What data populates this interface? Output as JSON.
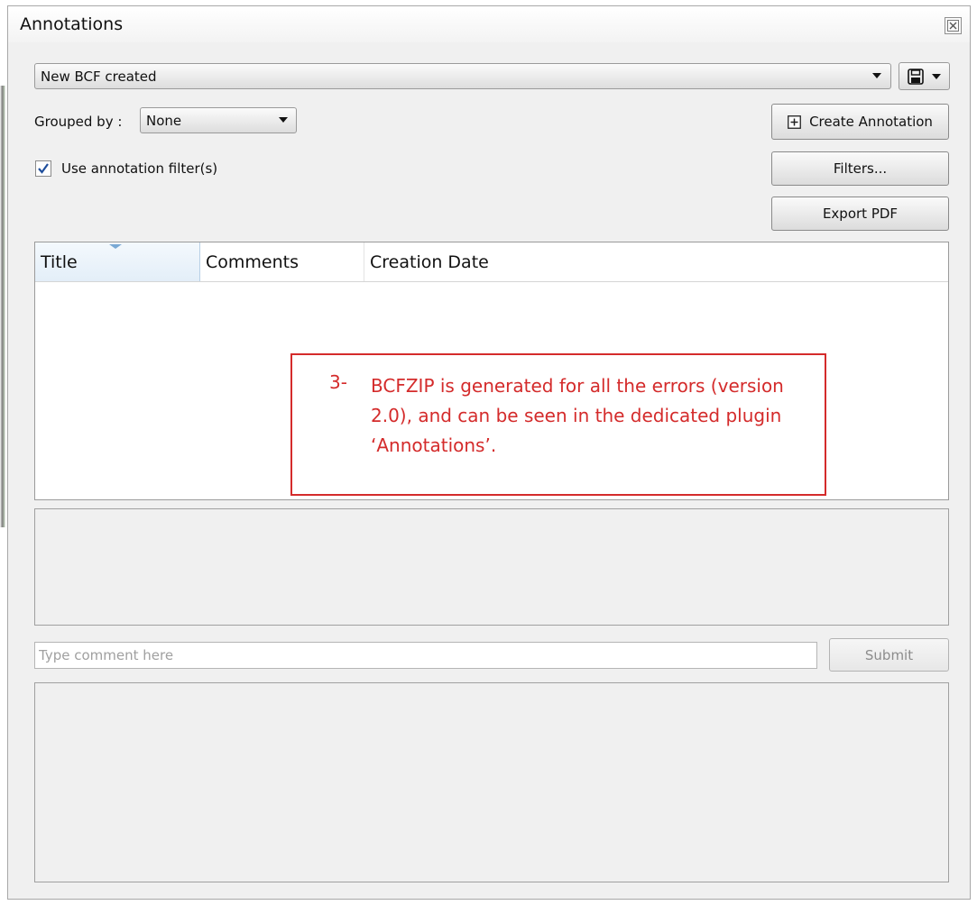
{
  "window": {
    "title": "Annotations",
    "close_icon": "close-icon"
  },
  "bcf_selector": {
    "selected": "New BCF created",
    "save_icon": "floppy-disk-icon"
  },
  "grouping": {
    "label": "Grouped by :",
    "selected": "None"
  },
  "filter_checkbox": {
    "label": "Use annotation filter(s)",
    "checked": true
  },
  "buttons": {
    "create_annotation": "Create Annotation",
    "filters": "Filters...",
    "export_pdf": "Export PDF",
    "submit": "Submit"
  },
  "annotation_list": {
    "columns": [
      "Title",
      "Comments",
      "Creation Date"
    ],
    "sorted_column": "Title",
    "rows": []
  },
  "callout": {
    "number": "3-",
    "text": "BCFZIP is generated for all the errors (version 2.0), and can be seen in the dedicated plugin ‘Annotations’.",
    "color": "#d42b2b"
  },
  "comment": {
    "placeholder": "Type comment here",
    "value": ""
  },
  "colors": {
    "window_bg": "#f0f0f0",
    "sorted_header": "#e3eef8"
  }
}
